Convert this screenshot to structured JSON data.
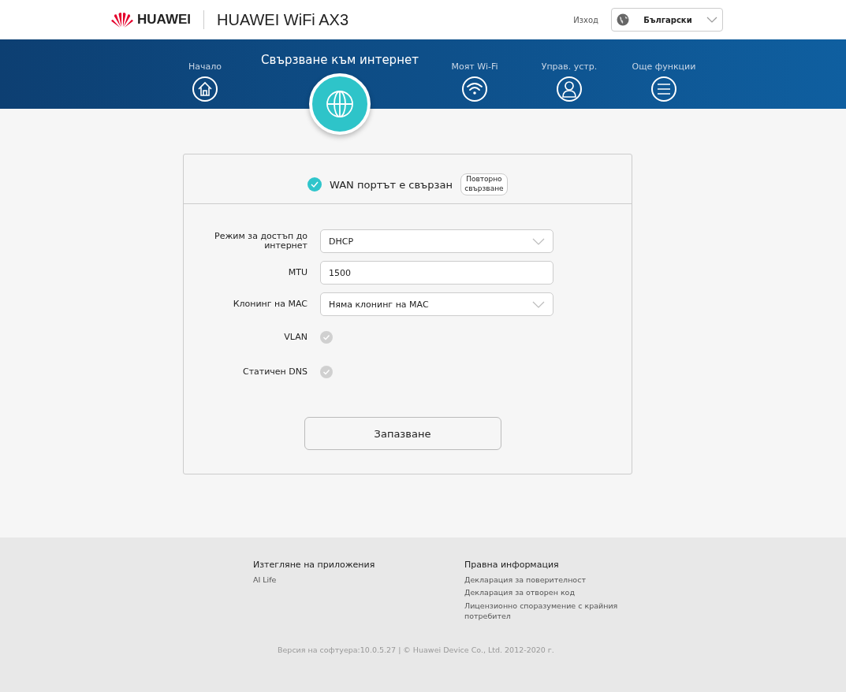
{
  "header": {
    "brand": "HUAWEI",
    "product": "HUAWEI WiFi AX3",
    "logout": "Изход",
    "language": "Български"
  },
  "nav": [
    {
      "label": "Начало",
      "kind": "home",
      "selected": false
    },
    {
      "label": "Свързване към интернет",
      "kind": "globe",
      "selected": true
    },
    {
      "label": "Моят Wi-Fi",
      "kind": "wifi",
      "selected": false
    },
    {
      "label": "Управ. устр.",
      "kind": "person",
      "selected": false
    },
    {
      "label": "Още функции",
      "kind": "menu",
      "selected": false
    }
  ],
  "status": {
    "text": "WAN портът е свързан",
    "connected": true,
    "button": "Повторно свързване"
  },
  "form": [
    {
      "kind": "select",
      "label": "Режим за достъп до интернет",
      "value": "DHCP"
    },
    {
      "kind": "text",
      "label": "MTU",
      "value": "1500"
    },
    {
      "kind": "select",
      "label": "Клонинг на MAC",
      "value": "Няма клонинг на MAC"
    },
    {
      "kind": "checkbox",
      "label": "VLAN",
      "checked": false
    },
    {
      "kind": "checkbox",
      "label": "Статичен DNS",
      "checked": false
    }
  ],
  "save_button": "Запазване",
  "footer": {
    "columns": [
      {
        "title": "Изтегляне на приложения",
        "links": [
          "AI Life"
        ]
      },
      {
        "title": "Правна информация",
        "links": [
          "Декларация за поверителност",
          "Декларация за отворен код",
          "Лицензионно споразумение с крайния потребител"
        ]
      }
    ],
    "version": "Версия на софтуера:10.0.5.27 |  © Huawei Device Co., Ltd. 2012-2020 г."
  }
}
